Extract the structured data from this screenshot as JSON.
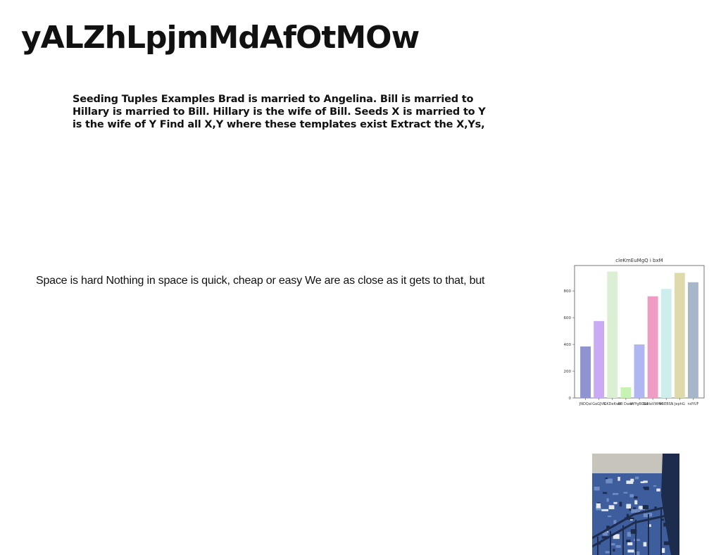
{
  "page": {
    "title": "yALZhLpjmMdAfOtMOw",
    "paragraph_1": "Seeding Tuples Examples Brad is married to Angelina. Bill is married to Hillary is married to Bill. Hillary is the wife of Bill. Seeds X is married to Y is the wife of Y Find all X,Y where these templates exist Extract the X,Ys,",
    "paragraph_2": "Space is hard Nothing in space is quick, cheap or easy We are as close as it gets to that, but"
  },
  "chart_data": {
    "type": "bar",
    "title": "cleKmEuMgQ i bxM",
    "categories": [
      "JNDQal",
      "GaGJVK",
      "GKDeKwe",
      "EB Dawk",
      "VYPgBGGL",
      "SeHaVWHK",
      "NREBSN",
      "JephG",
      "ndYUF"
    ],
    "values": [
      385,
      575,
      945,
      80,
      400,
      760,
      815,
      935,
      865
    ],
    "colors": [
      "#8f93cf",
      "#caaaf2",
      "#dcefd4",
      "#c8f2b4",
      "#b0b6ef",
      "#ef9cc4",
      "#cdeeed",
      "#dedaaa",
      "#a8b6c9"
    ],
    "yticks": [
      0,
      200,
      400,
      600,
      800
    ],
    "ylim": [
      0,
      990
    ],
    "grid": false
  },
  "photo": {
    "colors": [
      "#c7c4bc",
      "#3d5d9c",
      "#1d2c4c",
      "#e4e8ef"
    ]
  }
}
